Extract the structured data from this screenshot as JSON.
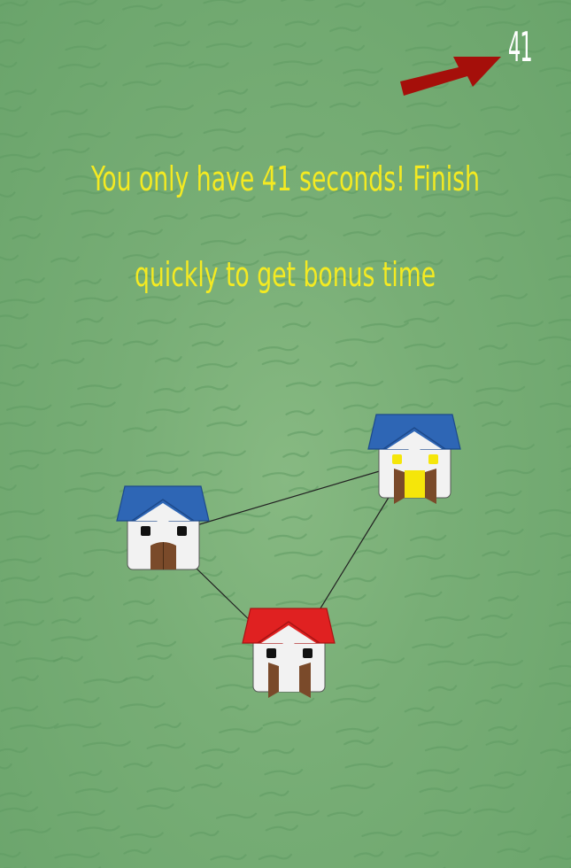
{
  "hud": {
    "timer_value": "41",
    "arrow_color": "#a50f0a"
  },
  "message": {
    "line1": "You only have 41 seconds! Finish",
    "line2": "quickly to get bonus time",
    "color": "#f4ea22"
  },
  "houses": [
    {
      "name": "house-blue-left",
      "roof_color": "#2e66b5",
      "windows": "dark",
      "door": "closed"
    },
    {
      "name": "house-blue-right",
      "roof_color": "#2e66b5",
      "windows": "lit",
      "door": "open"
    },
    {
      "name": "house-red-bottom",
      "roof_color": "#e02121",
      "windows": "dark",
      "door": "open"
    }
  ],
  "connections": [
    {
      "from": "house-blue-left",
      "to": "house-blue-right"
    },
    {
      "from": "house-blue-left",
      "to": "house-red-bottom"
    },
    {
      "from": "house-blue-right",
      "to": "house-red-bottom"
    }
  ],
  "colors": {
    "grass": "#78ae76",
    "wall": "#f2f2f2",
    "door": "#7a4a2a",
    "window_dark": "#111111",
    "window_lit": "#f5e60a"
  }
}
